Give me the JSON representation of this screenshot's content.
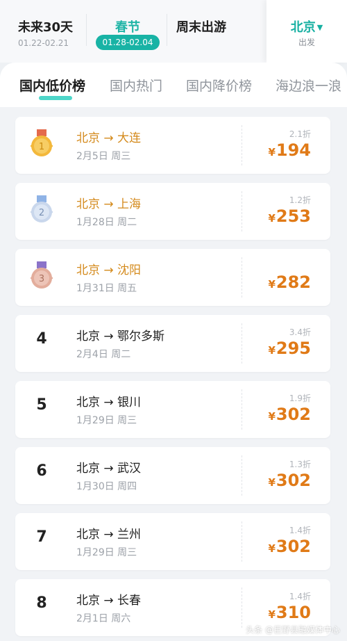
{
  "date_bar": {
    "segments": [
      {
        "title": "未来30天",
        "sub": "01.22-02.21"
      },
      {
        "title": "春节",
        "sub": "01.28-02.04"
      },
      {
        "title": "周末出游",
        "sub": ""
      },
      {
        "title": "北京",
        "sub": "出发"
      }
    ]
  },
  "tabs": [
    "国内低价榜",
    "国内热门",
    "国内降价榜",
    "海边浪一浪"
  ],
  "list": [
    {
      "rank": "1",
      "route": "北京 → 大连",
      "date": "2月5日 周三",
      "discount": "2.1折",
      "currency": "¥",
      "price": "194"
    },
    {
      "rank": "2",
      "route": "北京 → 上海",
      "date": "1月28日 周二",
      "discount": "1.2折",
      "currency": "¥",
      "price": "253"
    },
    {
      "rank": "3",
      "route": "北京 → 沈阳",
      "date": "1月31日 周五",
      "discount": "",
      "currency": "¥",
      "price": "282"
    },
    {
      "rank": "4",
      "route": "北京 → 鄂尔多斯",
      "date": "2月4日 周二",
      "discount": "3.4折",
      "currency": "¥",
      "price": "295"
    },
    {
      "rank": "5",
      "route": "北京 → 银川",
      "date": "1月29日 周三",
      "discount": "1.9折",
      "currency": "¥",
      "price": "302"
    },
    {
      "rank": "6",
      "route": "北京 → 武汉",
      "date": "1月30日 周四",
      "discount": "1.3折",
      "currency": "¥",
      "price": "302"
    },
    {
      "rank": "7",
      "route": "北京 → 兰州",
      "date": "1月29日 周三",
      "discount": "1.4折",
      "currency": "¥",
      "price": "302"
    },
    {
      "rank": "8",
      "route": "北京 → 长春",
      "date": "2月1日 周六",
      "discount": "1.4折",
      "currency": "¥",
      "price": "310"
    }
  ],
  "medals": {
    "gold": "#f3b83b",
    "silver": "#c9d7ec",
    "bronze": "#e3ad9c"
  },
  "watermark": "头条 @巨野县融媒体中心",
  "colors": {
    "accent": "#18b3a5",
    "price": "#e07a17",
    "top_route": "#d48a1c"
  }
}
